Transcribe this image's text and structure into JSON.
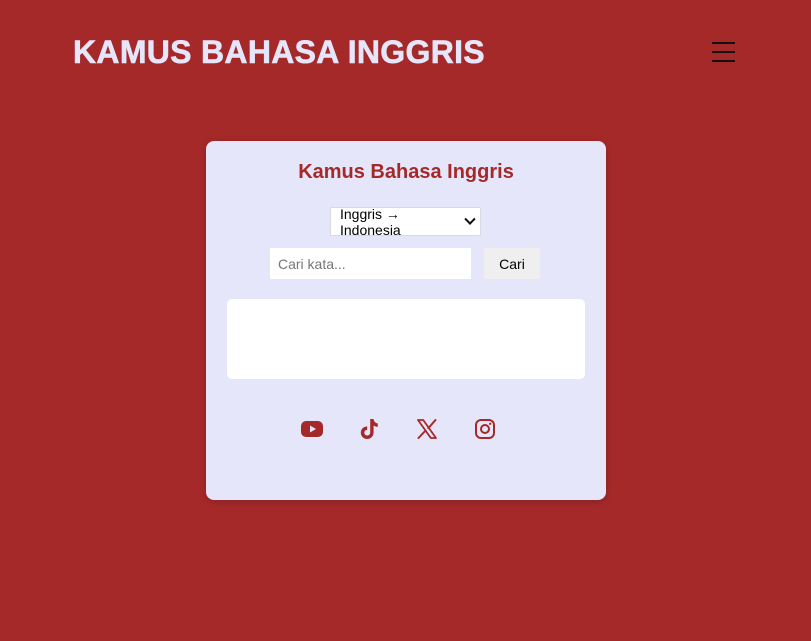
{
  "header": {
    "site_title": "KAMUS BAHASA INGGRIS",
    "menu_icon": "hamburger-menu-icon"
  },
  "card": {
    "title": "Kamus Bahasa Inggris",
    "direction_select": {
      "selected": "Inggris → Indonesia",
      "options": [
        "Inggris → Indonesia"
      ]
    },
    "search": {
      "placeholder": "Cari kata...",
      "value": "",
      "button_label": "Cari"
    },
    "result": ""
  },
  "social": [
    {
      "icon": "youtube-icon"
    },
    {
      "icon": "tiktok-icon"
    },
    {
      "icon": "x-twitter-icon"
    },
    {
      "icon": "instagram-icon"
    }
  ],
  "colors": {
    "background": "#a6292a",
    "card_background": "#e6e6fa",
    "accent": "#a6292a"
  }
}
